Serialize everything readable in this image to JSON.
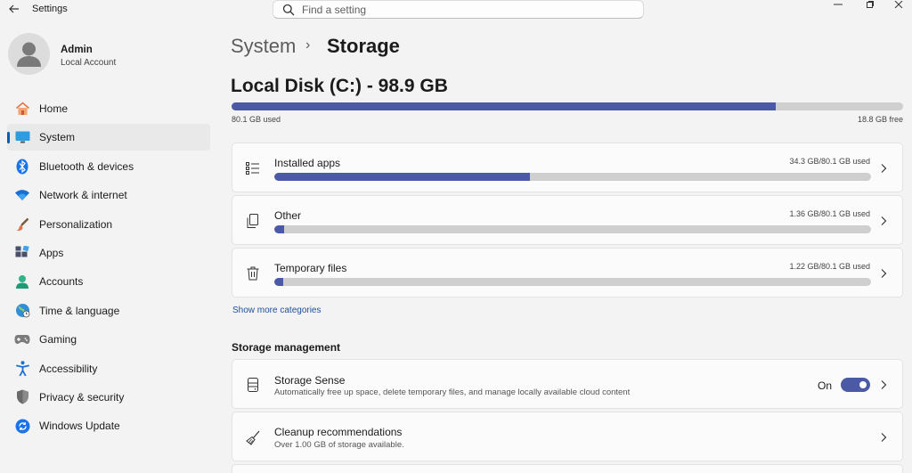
{
  "window": {
    "title": "Settings",
    "search_placeholder": "Find a setting"
  },
  "profile": {
    "name": "Admin",
    "account_type": "Local Account"
  },
  "sidebar": {
    "items": [
      {
        "label": "Home",
        "icon": "home-icon"
      },
      {
        "label": "System",
        "icon": "system-icon",
        "active": true
      },
      {
        "label": "Bluetooth & devices",
        "icon": "bluetooth-icon"
      },
      {
        "label": "Network & internet",
        "icon": "network-icon"
      },
      {
        "label": "Personalization",
        "icon": "brush-icon"
      },
      {
        "label": "Apps",
        "icon": "apps-icon"
      },
      {
        "label": "Accounts",
        "icon": "accounts-icon"
      },
      {
        "label": "Time & language",
        "icon": "globe-icon"
      },
      {
        "label": "Gaming",
        "icon": "gaming-icon"
      },
      {
        "label": "Accessibility",
        "icon": "accessibility-icon"
      },
      {
        "label": "Privacy & security",
        "icon": "shield-icon"
      },
      {
        "label": "Windows Update",
        "icon": "update-icon"
      }
    ]
  },
  "breadcrumb": {
    "parent": "System",
    "separator": "›",
    "current": "Storage"
  },
  "disk": {
    "title": "Local Disk (C:) - 98.9 GB",
    "used_label": "80.1 GB used",
    "free_label": "18.8 GB free",
    "used_fraction": 0.81
  },
  "categories": [
    {
      "title": "Installed apps",
      "usage": "34.3 GB/80.1 GB used",
      "fraction": 0.428,
      "icon": "list-icon"
    },
    {
      "title": "Other",
      "usage": "1.36 GB/80.1 GB used",
      "fraction": 0.017,
      "icon": "document-icon"
    },
    {
      "title": "Temporary files",
      "usage": "1.22 GB/80.1 GB used",
      "fraction": 0.015,
      "icon": "trash-icon"
    }
  ],
  "show_more": "Show more categories",
  "storage_management": {
    "header": "Storage management",
    "storage_sense": {
      "title": "Storage Sense",
      "description": "Automatically free up space, delete temporary files, and manage locally available cloud content",
      "toggle_label": "On",
      "toggle_on": true
    },
    "cleanup": {
      "title": "Cleanup recommendations",
      "description": "Over 1.00 GB of storage available."
    }
  },
  "colors": {
    "accent": "#4c5aa6",
    "bar_track": "#cfcfcf",
    "active_indicator": "#005fb8",
    "link": "#1f4f9b"
  }
}
